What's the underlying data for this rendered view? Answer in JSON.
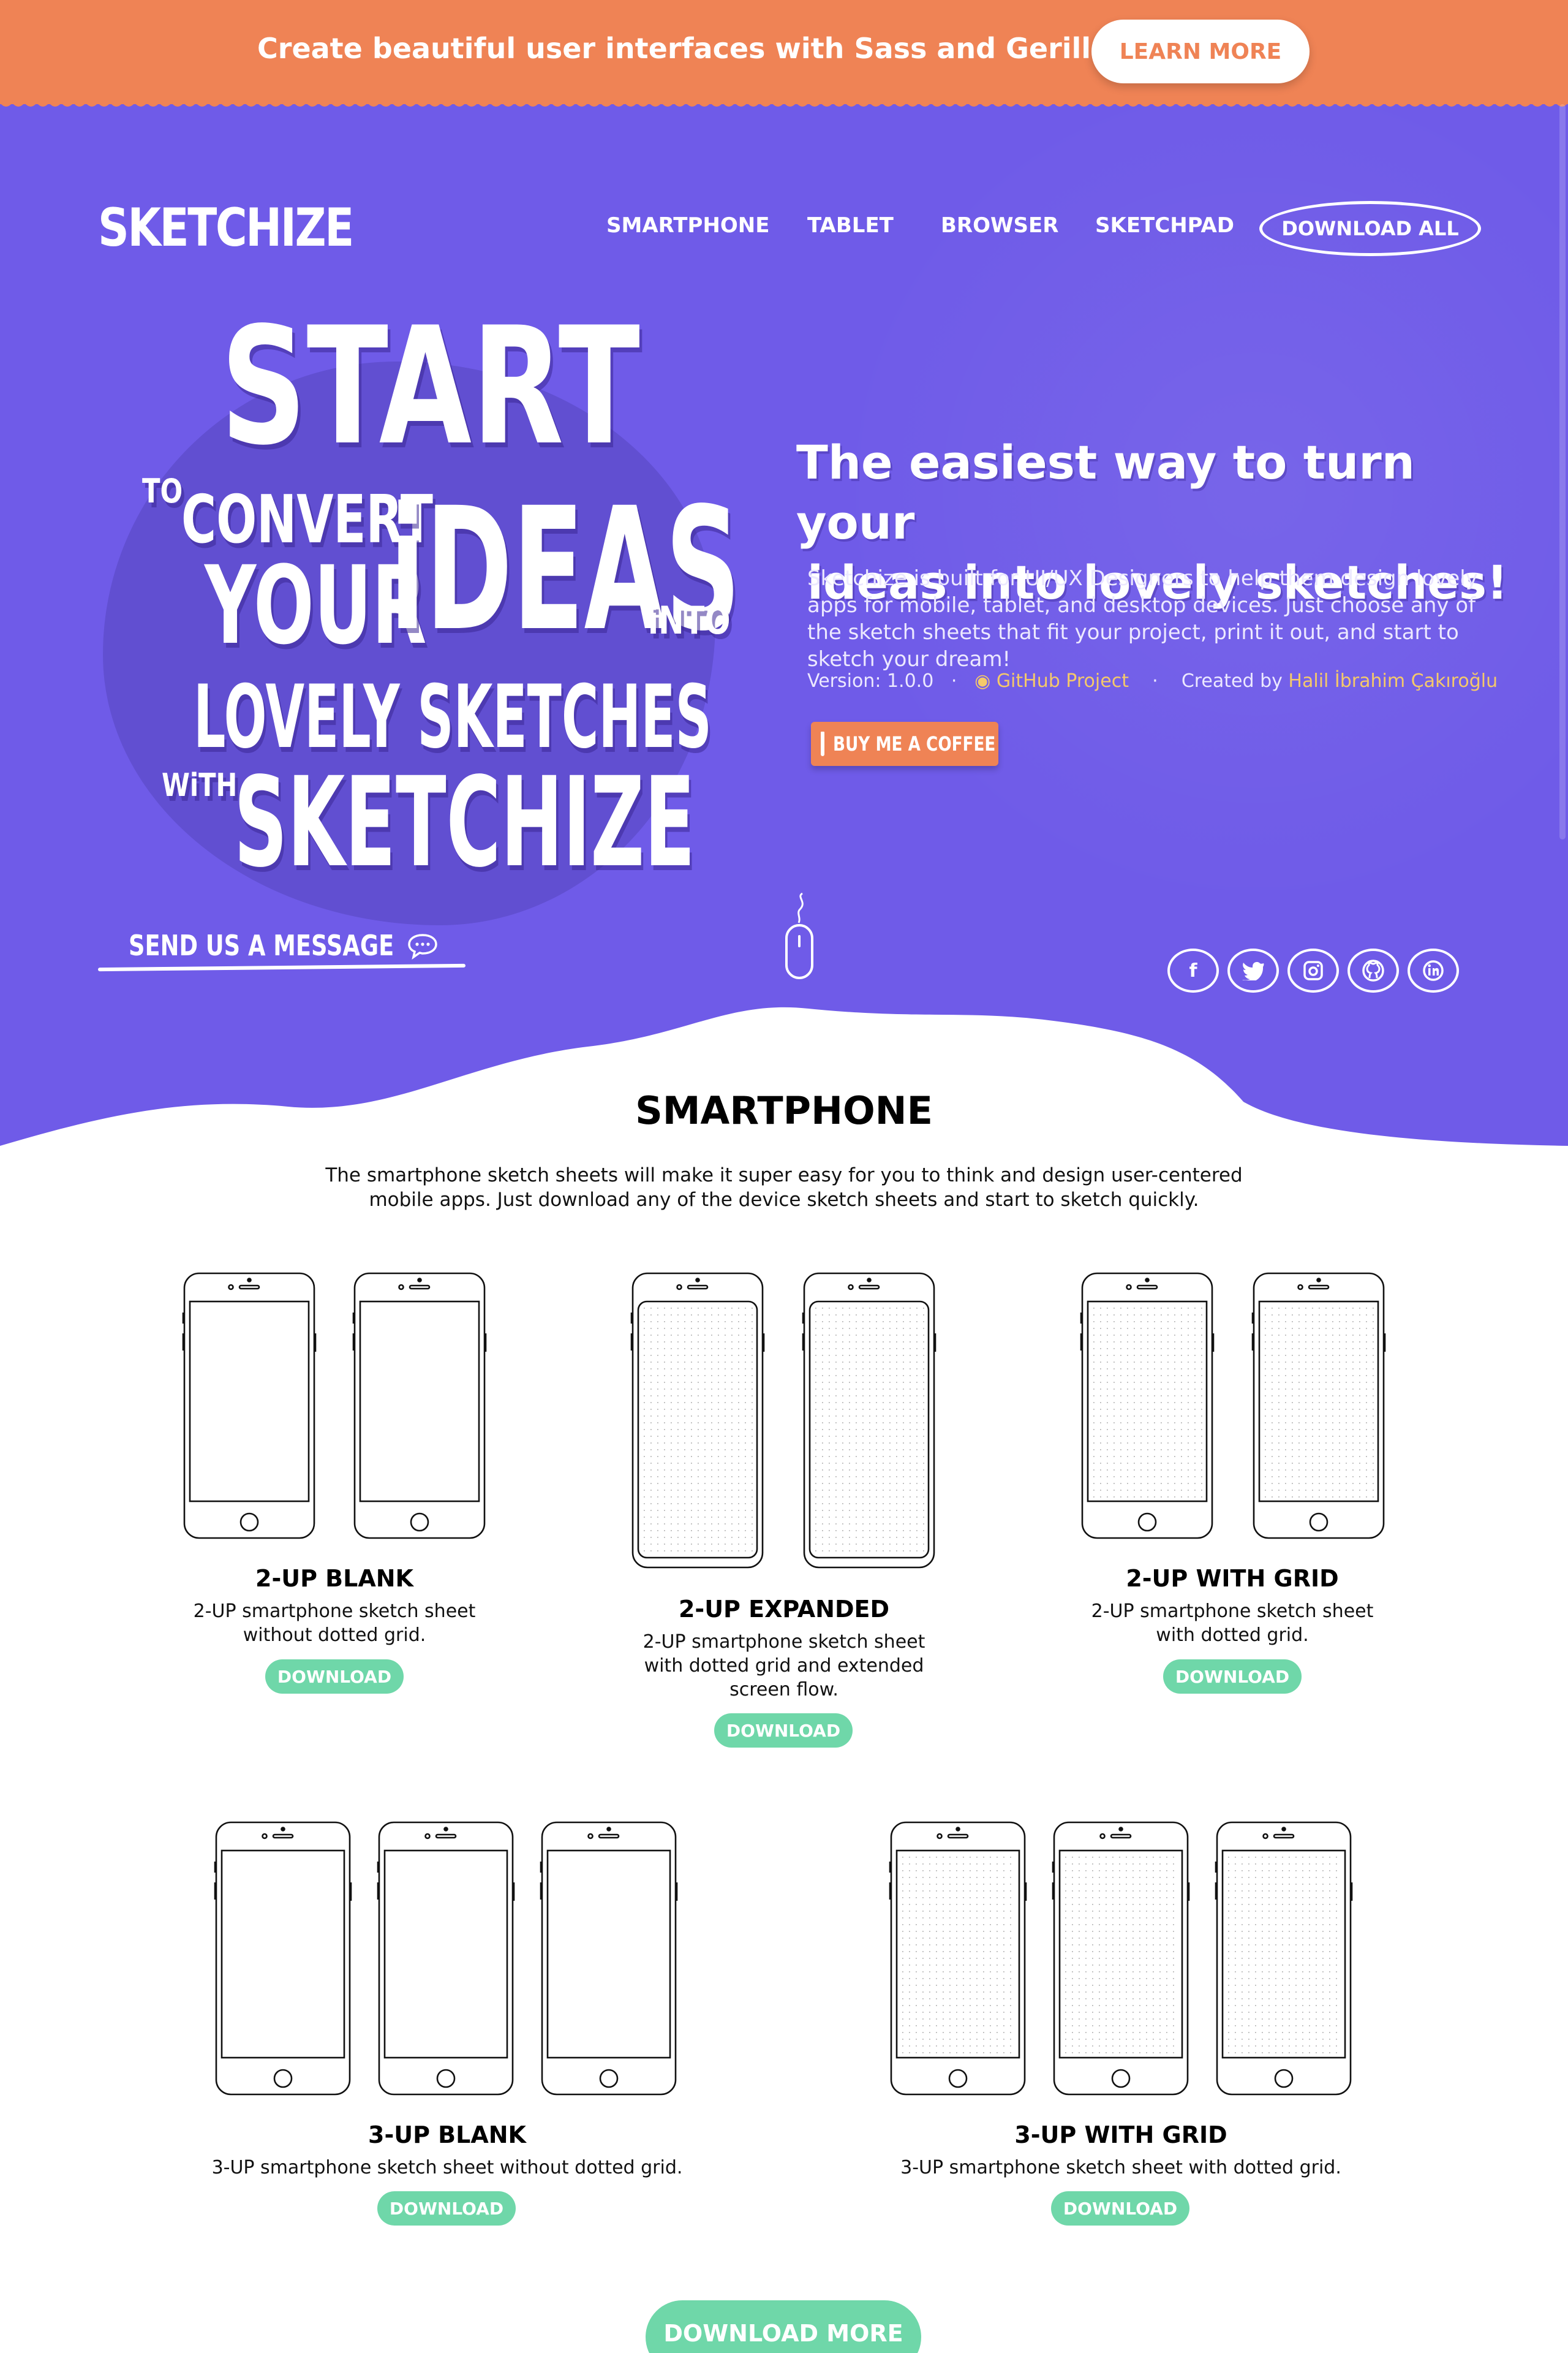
{
  "promo": {
    "text": "Create beautiful user interfaces with Sass and Gerillass!",
    "button_label": "LEARN MORE"
  },
  "header": {
    "logo": "SKETCHIZE",
    "nav": [
      "SMARTPHONE",
      "TABLET",
      "BROWSER",
      "SKETCHPAD"
    ],
    "download_all": "DOWNLOAD ALL"
  },
  "hero": {
    "words": {
      "start": "START",
      "to": "TO",
      "convert": "CONVERT",
      "your": "YOUR",
      "ideas": "iDEAS",
      "into": "iNTO",
      "lovely": "LOVELY SKETCHES",
      "with": "WiTH",
      "sketchize": "SKETCHIZE"
    },
    "headline_line1": "The easiest way to turn your",
    "headline_line2": "ideas into lovely sketches!",
    "description": "Sketchize is built for UI/UX Designers to help them design lovely apps for mobile, tablet, and desktop devices. Just choose any of the sketch sheets that fit your project, print it out, and start to sketch your dream!",
    "version": "Version: 1.0.0",
    "github_label": "GitHub Project",
    "created_by": "Created by",
    "author": "Halil İbrahim Çakıroğlu",
    "coffee_label": "BUY ME A COFFEE",
    "send_message": "SEND US A MESSAGE",
    "social": [
      "facebook",
      "twitter",
      "instagram",
      "github",
      "linkedin"
    ]
  },
  "section": {
    "title": "SMARTPHONE",
    "description": "The smartphone sketch sheets will make it super easy for you to think and design user-centered mobile apps. Just download any of the device sketch sheets and start to sketch quickly.",
    "cards": [
      {
        "title": "2-UP BLANK",
        "desc_lines": [
          "2-UP smartphone sketch sheet",
          "without dotted grid."
        ],
        "button": "DOWNLOAD"
      },
      {
        "title": "2-UP EXPANDED",
        "desc_lines": [
          "2-UP smartphone sketch sheet",
          "with dotted grid and extended",
          "screen flow."
        ],
        "button": "DOWNLOAD"
      },
      {
        "title": "2-UP WITH GRID",
        "desc_lines": [
          "2-UP smartphone sketch sheet",
          "with dotted grid."
        ],
        "button": "DOWNLOAD"
      },
      {
        "title": "3-UP BLANK",
        "desc_lines": [
          "3-UP smartphone sketch sheet without dotted grid."
        ],
        "button": "DOWNLOAD"
      },
      {
        "title": "3-UP WITH GRID",
        "desc_lines": [
          "3-UP smartphone sketch sheet with dotted grid."
        ],
        "button": "DOWNLOAD"
      }
    ],
    "more_button": "DOWNLOAD MORE"
  },
  "colors": {
    "promo": "#ef8355",
    "hero": "#6f5be8",
    "accent_green": "#6fd7a9",
    "link_yellow": "#f5c96a"
  }
}
